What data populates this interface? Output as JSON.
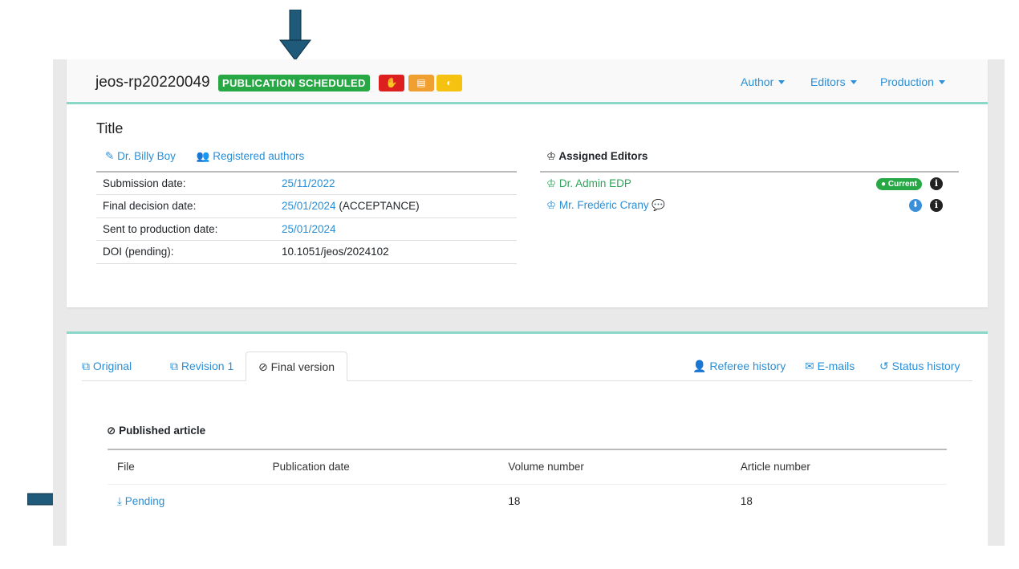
{
  "manuscript": {
    "id": "jeos-rp20220049",
    "status": "PUBLICATION SCHEDULED",
    "title": "Title"
  },
  "topnav": {
    "author": "Author",
    "editors": "Editors",
    "production": "Production"
  },
  "authors": {
    "main_author": "Dr. Billy Boy",
    "registered": "Registered authors"
  },
  "info_rows": [
    {
      "label": "Submission date:",
      "value": "25/11/2022",
      "suffix": ""
    },
    {
      "label": "Final decision date:",
      "value": "25/01/2024",
      "suffix": " (ACCEPTANCE)"
    },
    {
      "label": "Sent to production date:",
      "value": "25/01/2024",
      "suffix": ""
    },
    {
      "label": "DOI (pending):",
      "value": "10.1051/jeos/2024102",
      "suffix": ""
    }
  ],
  "editors": {
    "heading": "Assigned Editors",
    "list": [
      {
        "name": "Dr. Admin EDP",
        "badge": "Current"
      },
      {
        "name": "Mr. Fredéric Crany"
      }
    ]
  },
  "tabs": {
    "original": "Original",
    "revision1": "Revision 1",
    "final": "Final version",
    "referee_history": "Referee history",
    "emails": "E-mails",
    "status_history": "Status history"
  },
  "published": {
    "heading": "Published article",
    "columns": [
      "File",
      "Publication date",
      "Volume number",
      "Article number"
    ],
    "row": {
      "file": "Pending",
      "publication_date": "",
      "volume": "18",
      "article": "18"
    }
  },
  "colors": {
    "accent": "#2a8fd6",
    "success": "#28a745",
    "teal_border": "#8cd8c8",
    "arrow": "#1f5a7a"
  }
}
